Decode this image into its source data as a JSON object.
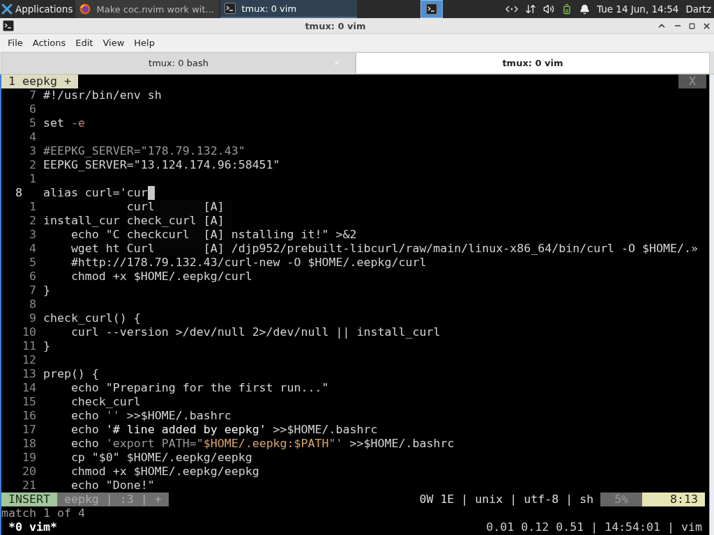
{
  "panel": {
    "apps_label": "Applications",
    "tasks": [
      {
        "title": "Make coc.nvim work wit...",
        "selected": false,
        "kind": "browser"
      },
      {
        "title": "tmux: 0 vim",
        "selected": true,
        "kind": "terminal"
      }
    ],
    "clock": "Tue 14 Jun, 14:54",
    "user": "Dartz"
  },
  "window": {
    "title": "tmux: 0 vim"
  },
  "menu": [
    "File",
    "Actions",
    "Edit",
    "View",
    "Help"
  ],
  "tabs": [
    {
      "label": "tmux: 0 bash",
      "selected": false
    },
    {
      "label": "tmux: 0 vim",
      "selected": true
    }
  ],
  "vim": {
    "tabline": {
      "label": "1 eepkg +",
      "close": "X"
    },
    "lines": [
      {
        "num": "7",
        "current": false,
        "tokens": [
          {
            "text": "#!/usr/bin/env sh",
            "kind": "plain"
          }
        ]
      },
      {
        "num": "6",
        "current": false
      },
      {
        "num": "5",
        "current": false,
        "tokens": [
          {
            "text": "set ",
            "kind": "plain"
          },
          {
            "text": "-e",
            "kind": "flag"
          }
        ]
      },
      {
        "num": "4",
        "current": false
      },
      {
        "num": "3",
        "current": false,
        "tokens": [
          {
            "text": "#EEPKG_SERVER=\"178.79.132.43\"",
            "kind": "comment"
          }
        ]
      },
      {
        "num": "2",
        "current": false,
        "tokens": [
          {
            "text": "EEPKG_SERVER=\"13.124.174.96:58451\"",
            "kind": "plain"
          }
        ]
      },
      {
        "num": "1",
        "current": false
      },
      {
        "num": "8",
        "current": true,
        "tokens": [
          {
            "text": "alias curl='cur",
            "kind": "plain"
          }
        ]
      },
      {
        "num": "1",
        "current": false,
        "popup": {
          "word": "curl",
          "tag": "[A]",
          "selected": false
        }
      },
      {
        "num": "2",
        "current": false,
        "tokens": [
          {
            "text": "install_cur",
            "kind": "plain"
          }
        ],
        "popup": {
          "word": "check_curl",
          "tag": "[A]",
          "selected": false
        }
      },
      {
        "num": "3",
        "current": false,
        "tokens": [
          {
            "text": "    echo \"C",
            "kind": "plain"
          }
        ],
        "popup": {
          "word": "checkcurl",
          "tag": "[A]",
          "selected": false
        },
        "after": "nstalling it!\" >&2"
      },
      {
        "num": "4",
        "current": false,
        "tokens": [
          {
            "text": "    wget ht",
            "kind": "plain"
          }
        ],
        "popup": {
          "word": "Curl",
          "tag": "[A]",
          "selected": false
        },
        "after": "/djp952/prebuilt-libcurl/raw/main/linux-x86_64/bin/curl -O $HOME/.»"
      },
      {
        "num": "5",
        "current": false,
        "tokens": [
          {
            "text": "    #http://178.79.132.43/curl-new -O $HOME/.eepkg/curl",
            "kind": "plain"
          }
        ]
      },
      {
        "num": "6",
        "current": false,
        "tokens": [
          {
            "text": "    chmod +x $HOME/.eepkg/curl",
            "kind": "plain"
          }
        ]
      },
      {
        "num": "7",
        "current": false,
        "tokens": [
          {
            "text": "}",
            "kind": "plain"
          }
        ]
      },
      {
        "num": "8",
        "current": false
      },
      {
        "num": "9",
        "current": false,
        "tokens": [
          {
            "text": "check_curl() {",
            "kind": "plain"
          }
        ]
      },
      {
        "num": "10",
        "current": false,
        "tokens": [
          {
            "text": "    curl --version >/dev/null 2>/dev/null || install_curl",
            "kind": "plain"
          }
        ]
      },
      {
        "num": "11",
        "current": false,
        "tokens": [
          {
            "text": "}",
            "kind": "plain"
          }
        ]
      },
      {
        "num": "12",
        "current": false
      },
      {
        "num": "13",
        "current": false,
        "tokens": [
          {
            "text": "prep() {",
            "kind": "plain"
          }
        ]
      },
      {
        "num": "14",
        "current": false,
        "tokens": [
          {
            "text": "    echo \"Preparing for the first run...\"",
            "kind": "plain"
          }
        ]
      },
      {
        "num": "15",
        "current": false,
        "tokens": [
          {
            "text": "    check_curl",
            "kind": "plain"
          }
        ]
      },
      {
        "num": "16",
        "current": false,
        "tokens": [
          {
            "text": "    echo ",
            "kind": "plain"
          },
          {
            "text": "''",
            "kind": "dim"
          },
          {
            "text": " >>$HOME/.bashrc",
            "kind": "plain"
          }
        ]
      },
      {
        "num": "17",
        "current": false,
        "tokens": [
          {
            "text": "    echo ",
            "kind": "plain"
          },
          {
            "text": "'# line added by eepkg'",
            "kind": "bright"
          },
          {
            "text": " >>$HOME/.bashrc",
            "kind": "plain"
          }
        ]
      },
      {
        "num": "18",
        "current": false,
        "tokens": [
          {
            "text": "    echo ",
            "kind": "plain"
          },
          {
            "text": "'export PATH=\"",
            "kind": "dim"
          },
          {
            "text": "$HOME/.eepkg:$PATH",
            "kind": "variable"
          },
          {
            "text": "\"'",
            "kind": "dim"
          },
          {
            "text": " >>$HOME/.bashrc",
            "kind": "plain"
          }
        ]
      },
      {
        "num": "19",
        "current": false,
        "tokens": [
          {
            "text": "    cp \"$0\" $HOME/.eepkg/eepkg",
            "kind": "plain"
          }
        ]
      },
      {
        "num": "20",
        "current": false,
        "tokens": [
          {
            "text": "    chmod +x $HOME/.eepkg/eepkg",
            "kind": "plain"
          }
        ]
      },
      {
        "num": "21",
        "current": false,
        "tokens": [
          {
            "text": "    echo \"Done!\"",
            "kind": "plain"
          }
        ]
      }
    ],
    "statusline": {
      "mode": "INSERT",
      "file_info": "eepkg | :3 | +",
      "info": "0W 1E | unix | utf-8 | sh",
      "percent": "5%",
      "position": "8:13"
    },
    "message": "match 1 of 4"
  },
  "tmux": {
    "window": "*0 vim*",
    "status": "0.01 0.12 0.51 | 14:54:01 | vim"
  }
}
